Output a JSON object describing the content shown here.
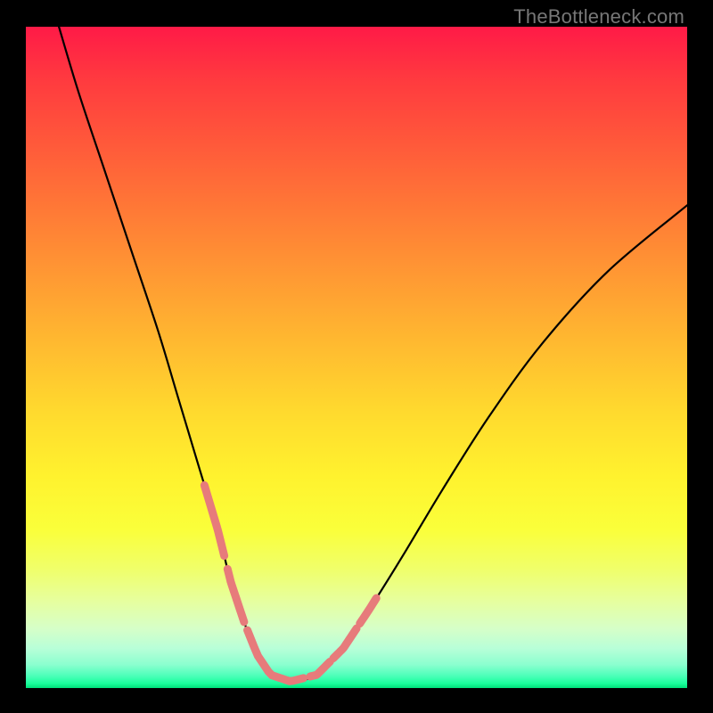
{
  "watermark": "TheBottleneck.com",
  "colors": {
    "frame": "#000000",
    "curve": "#000000",
    "markers": "#e77b7b",
    "gradient_top": "#ff1a47",
    "gradient_bottom": "#00e07a"
  },
  "chart_data": {
    "type": "line",
    "title": "",
    "xlabel": "",
    "ylabel": "",
    "xlim": [
      0,
      100
    ],
    "ylim": [
      0,
      100
    ],
    "series": [
      {
        "name": "bottleneck-curve",
        "x": [
          5,
          8,
          12,
          16,
          20,
          23,
          26,
          29,
          31,
          33,
          35,
          37,
          40,
          44,
          48,
          52,
          57,
          63,
          70,
          78,
          88,
          100
        ],
        "y": [
          100,
          90,
          78,
          66,
          54,
          44,
          34,
          24,
          16,
          10,
          5,
          2,
          1,
          2,
          6,
          12,
          20,
          30,
          41,
          52,
          63,
          73
        ]
      }
    ],
    "markers": {
      "name": "highlight-band",
      "x_ranges": [
        [
          27,
          30
        ],
        [
          30.5,
          33
        ],
        [
          33.5,
          42
        ],
        [
          43,
          46
        ],
        [
          46.5,
          50
        ],
        [
          50.5,
          53
        ]
      ],
      "stroke_width": 9
    }
  }
}
